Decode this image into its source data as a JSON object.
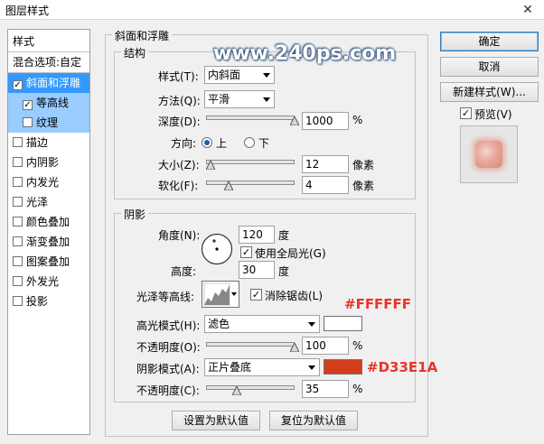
{
  "window": {
    "title": "图层样式",
    "close_glyph": "✕"
  },
  "watermark": "www.240ps.com",
  "style_list": {
    "header": "样式",
    "blend_options": "混合选项:自定",
    "items": [
      {
        "label": "斜面和浮雕",
        "checked": true,
        "state": "selected"
      },
      {
        "label": "等高线",
        "checked": true,
        "state": "sub"
      },
      {
        "label": "纹理",
        "checked": false,
        "state": "sub"
      },
      {
        "label": "描边",
        "checked": false
      },
      {
        "label": "内阴影",
        "checked": false
      },
      {
        "label": "内发光",
        "checked": false
      },
      {
        "label": "光泽",
        "checked": false
      },
      {
        "label": "颜色叠加",
        "checked": false
      },
      {
        "label": "渐变叠加",
        "checked": false
      },
      {
        "label": "图案叠加",
        "checked": false
      },
      {
        "label": "外发光",
        "checked": false
      },
      {
        "label": "投影",
        "checked": false
      }
    ]
  },
  "bevel": {
    "title": "斜面和浮雕",
    "structure": {
      "title": "结构",
      "style_label": "样式(T):",
      "style_value": "内斜面",
      "technique_label": "方法(Q):",
      "technique_value": "平滑",
      "depth_label": "深度(D):",
      "depth_value": "1000",
      "depth_unit": "%",
      "depth_level": 1.0,
      "direction_label": "方向:",
      "dir_up": "上",
      "dir_down": "下",
      "size_label": "大小(Z):",
      "size_value": "12",
      "size_unit": "像素",
      "size_level": 0.05,
      "soften_label": "软化(F):",
      "soften_value": "4",
      "soften_unit": "像素",
      "soften_level": 0.25
    },
    "shading": {
      "title": "阴影",
      "angle_label": "角度(N):",
      "angle_value": "120",
      "angle_unit": "度",
      "global_light_label": "使用全局光(G)",
      "altitude_label": "高度:",
      "altitude_value": "30",
      "altitude_unit": "度",
      "gloss_label": "光泽等高线:",
      "antialias_label": "消除锯齿(L)",
      "highlight_mode_label": "高光模式(H):",
      "highlight_mode_value": "滤色",
      "highlight_color": "#FFFFFF",
      "highlight_annotation": "#FFFFFF",
      "highlight_opacity_label": "不透明度(O):",
      "highlight_opacity_value": "100",
      "highlight_opacity_unit": "%",
      "highlight_opacity_level": 1.0,
      "shadow_mode_label": "阴影模式(A):",
      "shadow_mode_value": "正片叠底",
      "shadow_color": "#D33E1A",
      "shadow_annotation": "#D33E1A",
      "shadow_opacity_label": "不透明度(C):",
      "shadow_opacity_value": "35",
      "shadow_opacity_unit": "%",
      "shadow_opacity_level": 0.35
    },
    "make_default": "设置为默认值",
    "reset_default": "复位为默认值"
  },
  "buttons": {
    "ok": "确定",
    "cancel": "取消",
    "new_style": "新建样式(W)...",
    "preview": "预览(V)"
  },
  "colors": {
    "selection": "#3399ff",
    "sub_selection": "#99ccff",
    "annotation": "#e8352a"
  }
}
